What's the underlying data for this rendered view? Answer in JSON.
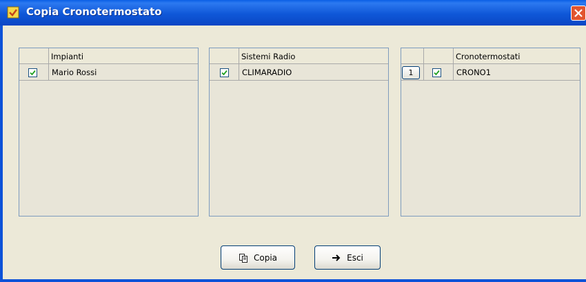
{
  "window": {
    "title": "Copia Cronotermostato"
  },
  "impianti": {
    "header": "Impianti",
    "rows": [
      {
        "checked": true,
        "name": "Mario Rossi"
      }
    ]
  },
  "sistemi": {
    "header": "Sistemi Radio",
    "rows": [
      {
        "checked": true,
        "name": "CLIMARADIO"
      }
    ]
  },
  "crono": {
    "header": "Cronotermostati",
    "rows": [
      {
        "index": "1",
        "checked": true,
        "name": "CRONO1"
      }
    ]
  },
  "buttons": {
    "copia": "Copia",
    "esci": "Esci"
  },
  "icons": {
    "title": "app-icon",
    "copy": "copy-icon",
    "exit": "arrow-right-icon",
    "check": "check-icon",
    "close": "close-icon"
  },
  "colors": {
    "titlebar": "#0a5fe6",
    "close": "#e2552f",
    "check": "#21a121"
  }
}
